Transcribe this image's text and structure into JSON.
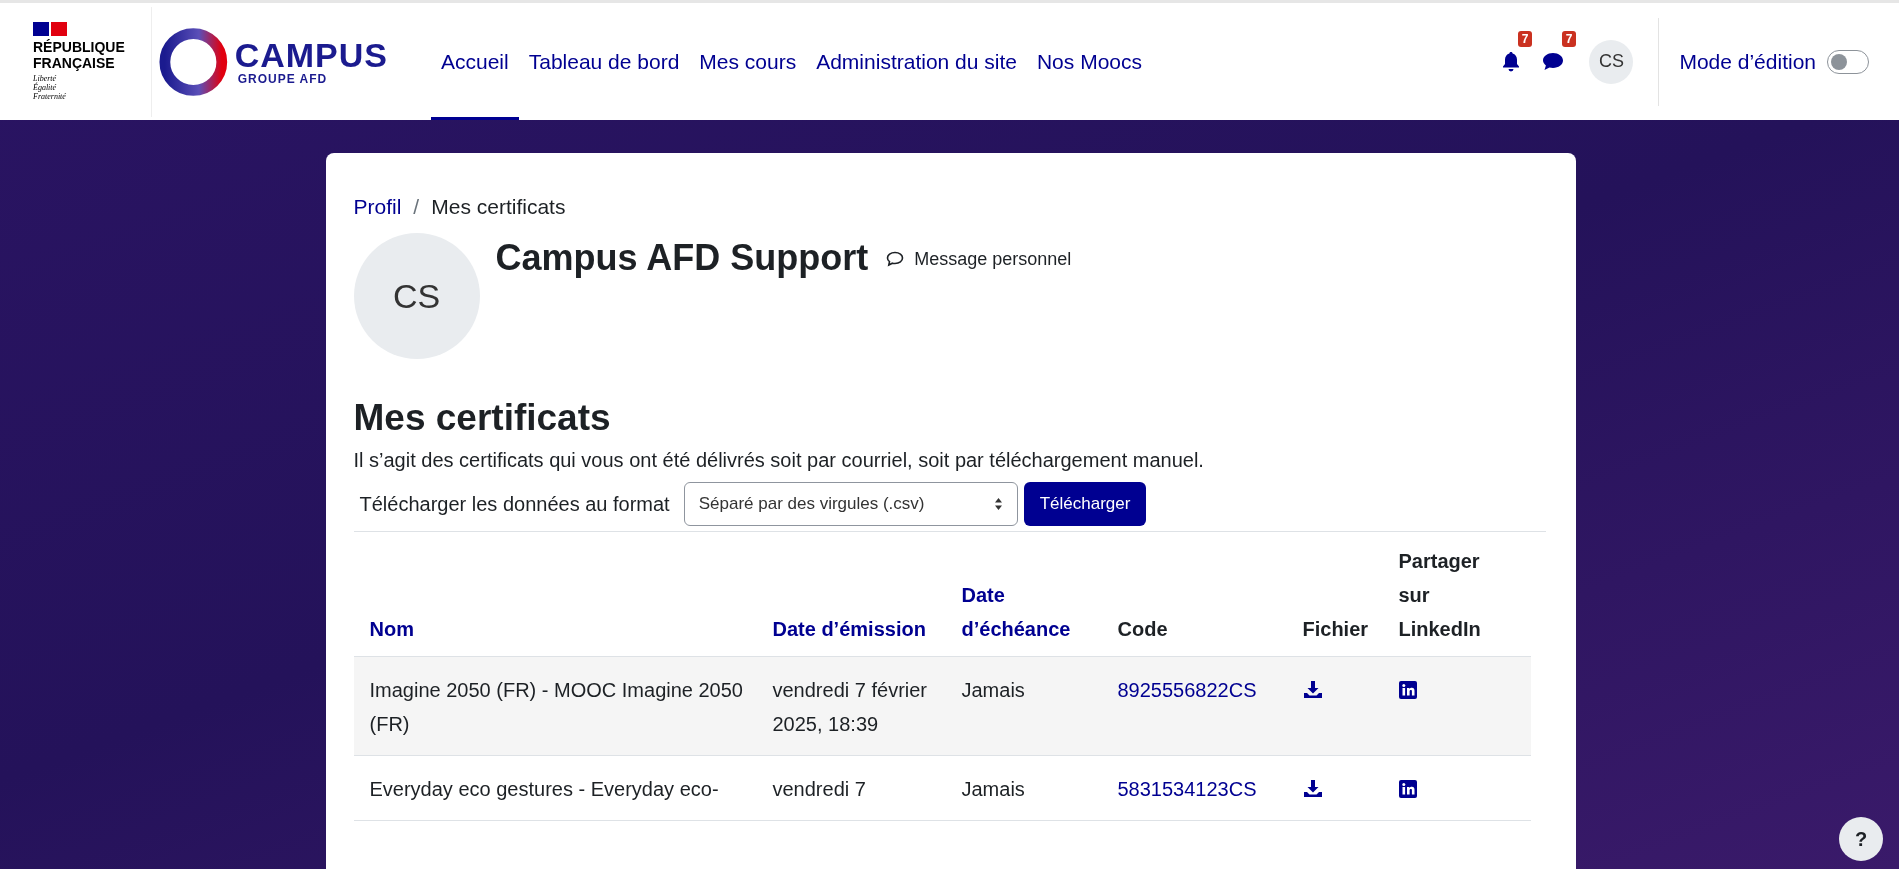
{
  "brand": {
    "gov_line1": "RÉPUBLIQUE",
    "gov_line2": "FRANÇAISE",
    "motto": [
      "Liberté",
      "Égalité",
      "Fraternité"
    ],
    "campus": "CAMPUS",
    "campus_sub": "GROUPE AFD"
  },
  "nav": [
    {
      "label": "Accueil",
      "selected": true
    },
    {
      "label": "Tableau de bord",
      "selected": false
    },
    {
      "label": "Mes cours",
      "selected": false
    },
    {
      "label": "Administration du site",
      "selected": false
    },
    {
      "label": "Nos Moocs",
      "selected": false
    }
  ],
  "notifications": {
    "count": "7"
  },
  "messages": {
    "count": "7"
  },
  "user_initials": "CS",
  "edit_mode": {
    "label": "Mode d’édition",
    "on": false
  },
  "breadcrumb": {
    "separator": "/",
    "items": [
      {
        "label": "Profil",
        "kind": "link"
      },
      {
        "label": "Mes certificats",
        "kind": "current"
      }
    ]
  },
  "profile": {
    "initials": "CS",
    "name": "Campus AFD Support",
    "message_link": "Message personnel"
  },
  "heading": "Mes certificats",
  "intro": "Il s’agit des certificats qui vous ont été délivrés soit par courriel, soit par téléchargement manuel.",
  "download": {
    "label": "Télécharger les données au format",
    "format": "Séparé par des virgules (.csv)",
    "button": "Télécharger"
  },
  "table": {
    "columns": [
      {
        "label": "Nom",
        "sortable": true
      },
      {
        "label": "Date d’émission",
        "sortable": true
      },
      {
        "label": "Date d’échéance",
        "sortable": true
      },
      {
        "label": "Code",
        "sortable": false
      },
      {
        "label": "Fichier",
        "sortable": false
      },
      {
        "label": "Partager sur LinkedIn",
        "sortable": false
      }
    ],
    "rows": [
      {
        "name": "Imagine 2050 (FR) - MOOC Imagine 2050 (FR)",
        "issued": "vendredi 7 février 2025, 18:39",
        "expires": "Jamais",
        "code": "8925556822CS"
      },
      {
        "name": "Everyday eco gestures - Everyday eco-",
        "issued": "vendredi 7",
        "expires": "Jamais",
        "code": "5831534123CS"
      }
    ]
  },
  "help": "?"
}
